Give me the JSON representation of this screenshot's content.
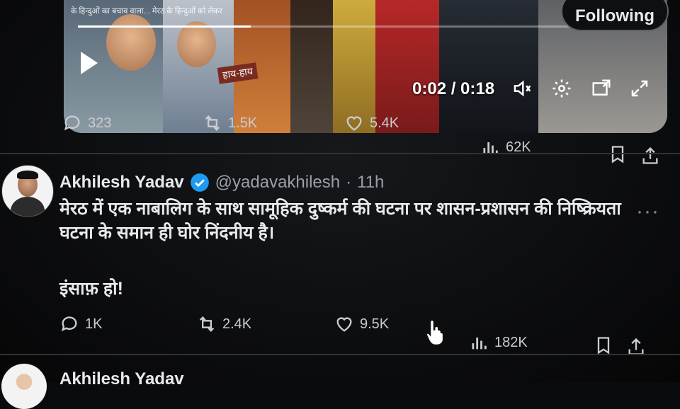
{
  "previous_tweet": {
    "video": {
      "caption": "के हिन्दुओं का बचाव वाला... मेरठ के हिन्दुओं को लेकर",
      "sign_text": "हाय-हाय",
      "timecode": "0:02 / 0:18"
    },
    "following_label": "Following",
    "actions": {
      "replies": "323",
      "reposts": "1.5K",
      "likes": "5.4K",
      "views": "62K"
    }
  },
  "tweet": {
    "author_name": "Akhilesh Yadav",
    "handle": "@yadavakhilesh",
    "separator": "·",
    "time": "11h",
    "text_lines": [
      "मेरठ में एक नाबालिग के साथ सामूहिक दुष्कर्म की घटना पर शासन-प्रशासन की निष्क्रियता",
      "घटना के समान ही घोर निंदनीय है।"
    ],
    "text_para2": "इंसाफ़ हो!",
    "more": "···",
    "actions": {
      "replies": "1K",
      "reposts": "2.4K",
      "likes": "9.5K",
      "views": "182K"
    }
  },
  "next_tweet": {
    "author_name": "Akhilesh Yadav"
  },
  "colors": {
    "background": "#0a0b0d",
    "text": "#e7e9ea",
    "muted": "#9aa0a6",
    "verified": "#1d9bf0"
  }
}
